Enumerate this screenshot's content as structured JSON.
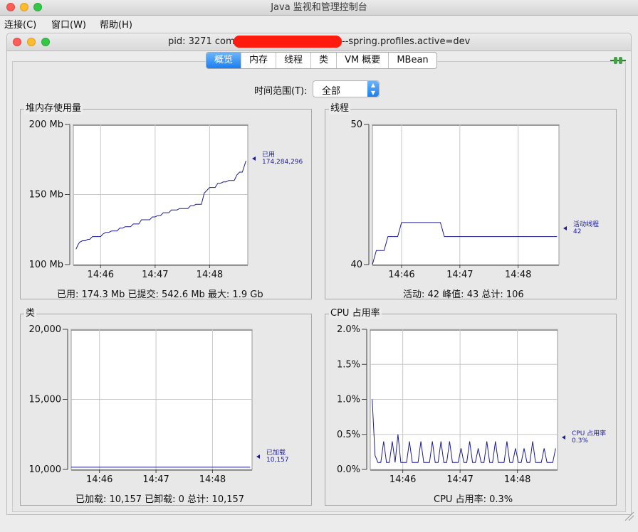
{
  "window": {
    "title": "Java 监视和管理控制台"
  },
  "menu": {
    "items": [
      "连接(C)",
      "窗口(W)",
      "帮助(H)"
    ]
  },
  "inner_window": {
    "title_prefix": "pid: 3271 com",
    "title_suffix": "--spring.profiles.active=dev"
  },
  "tabs": [
    {
      "label": "概览",
      "active": true
    },
    {
      "label": "内存",
      "active": false
    },
    {
      "label": "线程",
      "active": false
    },
    {
      "label": "类",
      "active": false
    },
    {
      "label": "VM 概要",
      "active": false
    },
    {
      "label": "MBean",
      "active": false
    }
  ],
  "time_range": {
    "label": "时间范围(T):",
    "value": "全部"
  },
  "colors": {
    "accent": "#1a7ff0",
    "series": "#1c1c94",
    "redaction": "#ff1c0e"
  },
  "icons": [
    "plug-connected-icon"
  ],
  "panels": {
    "heap": {
      "title": "堆内存使用量",
      "summary": "已用: 174.3 Mb    已提交: 542.6 Mb    最大: 1.9 Gb",
      "legend_name": "已用",
      "legend_value": "174,284,296"
    },
    "threads": {
      "title": "线程",
      "summary": "活动: 42    峰值: 43    总计: 106",
      "legend_name": "活动线程",
      "legend_value": "42"
    },
    "classes": {
      "title": "类",
      "summary": "已加载: 10,157    已卸载: 0    总计: 10,157",
      "legend_name": "已加载",
      "legend_value": "10,157"
    },
    "cpu": {
      "title": "CPU 占用率",
      "summary": "CPU 占用率: 0.3%",
      "legend_name": "CPU 占用率",
      "legend_value": "0.3%"
    }
  },
  "chart_data": [
    {
      "id": "heap",
      "type": "line",
      "series": [
        {
          "name": "已用",
          "x": [
            "14:45:33",
            "14:45:35",
            "14:45:37",
            "14:45:40",
            "14:45:43",
            "14:45:46",
            "14:45:48",
            "14:45:51",
            "14:45:54",
            "14:45:57",
            "14:46:00",
            "14:46:03",
            "14:46:06",
            "14:46:09",
            "14:46:12",
            "14:46:15",
            "14:46:18",
            "14:46:21",
            "14:46:24",
            "14:46:27",
            "14:46:30",
            "14:46:33",
            "14:46:36",
            "14:46:39",
            "14:46:42",
            "14:46:45",
            "14:46:48",
            "14:46:51",
            "14:46:54",
            "14:46:57",
            "14:47:00",
            "14:47:03",
            "14:47:06",
            "14:47:09",
            "14:47:12",
            "14:47:15",
            "14:47:18",
            "14:47:21",
            "14:47:24",
            "14:47:27",
            "14:47:30",
            "14:47:33",
            "14:47:36",
            "14:47:39",
            "14:47:42",
            "14:47:45",
            "14:47:48",
            "14:47:51",
            "14:47:54",
            "14:47:57",
            "14:48:00",
            "14:48:03",
            "14:48:06",
            "14:48:09",
            "14:48:12",
            "14:48:15",
            "14:48:18",
            "14:48:21",
            "14:48:24",
            "14:48:27",
            "14:48:30",
            "14:48:33",
            "14:48:36",
            "14:48:38",
            "14:48:40"
          ],
          "values": [
            111,
            114,
            116,
            117,
            117,
            118,
            118,
            120,
            120,
            120,
            120,
            122,
            123,
            123,
            124,
            124,
            124,
            126,
            126,
            127,
            127,
            127,
            129,
            129,
            129,
            132,
            132,
            132,
            132,
            134,
            134,
            135,
            135,
            137,
            137,
            137,
            139,
            139,
            139,
            140,
            140,
            140,
            140,
            142,
            142,
            143,
            143,
            143,
            151,
            153,
            155,
            155,
            155,
            158,
            158,
            159,
            159,
            160,
            160,
            160,
            164,
            166,
            166,
            170,
            174
          ]
        }
      ],
      "ylim": [
        100,
        200
      ],
      "yticks": [
        "100 Mb",
        "150 Mb",
        "200 Mb"
      ],
      "xticks": [
        "14:46",
        "14:47",
        "14:48"
      ]
    },
    {
      "id": "threads",
      "type": "line",
      "series": [
        {
          "name": "活动线程",
          "x": [
            "14:45:30",
            "14:45:34",
            "14:45:38",
            "14:45:42",
            "14:45:46",
            "14:45:50",
            "14:45:56",
            "14:46:00",
            "14:46:04",
            "14:46:10",
            "14:46:20",
            "14:46:30",
            "14:46:40",
            "14:46:44",
            "14:46:46",
            "14:47:00",
            "14:47:20",
            "14:47:40",
            "14:48:00",
            "14:48:20",
            "14:48:40"
          ],
          "values": [
            40,
            41,
            41,
            41,
            42,
            42,
            42,
            43,
            43,
            43,
            43,
            43,
            43,
            42,
            42,
            42,
            42,
            42,
            42,
            42,
            42
          ]
        }
      ],
      "ylim": [
        40,
        50
      ],
      "yticks": [
        "40",
        "50"
      ],
      "xticks": [
        "14:46",
        "14:47",
        "14:48"
      ]
    },
    {
      "id": "classes",
      "type": "line",
      "series": [
        {
          "name": "已加载",
          "x": [
            "14:45:30",
            "14:46:00",
            "14:46:30",
            "14:47:00",
            "14:47:30",
            "14:48:00",
            "14:48:30",
            "14:48:40"
          ],
          "values": [
            10157,
            10157,
            10157,
            10157,
            10157,
            10157,
            10157,
            10157
          ]
        }
      ],
      "ylim": [
        10000,
        20000
      ],
      "yticks": [
        "10,000",
        "15,000",
        "20,000"
      ],
      "xticks": [
        "14:46",
        "14:47",
        "14:48"
      ]
    },
    {
      "id": "cpu",
      "type": "line",
      "series": [
        {
          "name": "CPU 占用率",
          "x": [
            "14:45:28",
            "14:45:31",
            "14:45:34",
            "14:45:37",
            "14:45:40",
            "14:45:43",
            "14:45:46",
            "14:45:49",
            "14:45:52",
            "14:45:55",
            "14:45:58",
            "14:46:01",
            "14:46:04",
            "14:46:07",
            "14:46:10",
            "14:46:13",
            "14:46:16",
            "14:46:19",
            "14:46:22",
            "14:46:25",
            "14:46:28",
            "14:46:31",
            "14:46:34",
            "14:46:37",
            "14:46:40",
            "14:46:43",
            "14:46:46",
            "14:46:49",
            "14:46:52",
            "14:46:55",
            "14:46:58",
            "14:47:01",
            "14:47:04",
            "14:47:07",
            "14:47:10",
            "14:47:13",
            "14:47:16",
            "14:47:19",
            "14:47:22",
            "14:47:25",
            "14:47:28",
            "14:47:31",
            "14:47:34",
            "14:47:37",
            "14:47:40",
            "14:47:43",
            "14:47:46",
            "14:47:49",
            "14:47:52",
            "14:47:55",
            "14:47:58",
            "14:48:01",
            "14:48:04",
            "14:48:07",
            "14:48:10",
            "14:48:13",
            "14:48:16",
            "14:48:19",
            "14:48:22",
            "14:48:25",
            "14:48:28",
            "14:48:31",
            "14:48:34",
            "14:48:37",
            "14:48:40"
          ],
          "values": [
            1.0,
            0.2,
            0.1,
            0.1,
            0.4,
            0.1,
            0.1,
            0.4,
            0.1,
            0.5,
            0.1,
            0.1,
            0.1,
            0.4,
            0.1,
            0.1,
            0.1,
            0.4,
            0.1,
            0.1,
            0.1,
            0.4,
            0.1,
            0.1,
            0.4,
            0.1,
            0.1,
            0.4,
            0.1,
            0.1,
            0.1,
            0.3,
            0.1,
            0.1,
            0.4,
            0.1,
            0.1,
            0.3,
            0.1,
            0.1,
            0.4,
            0.1,
            0.1,
            0.4,
            0.1,
            0.1,
            0.1,
            0.4,
            0.1,
            0.1,
            0.3,
            0.1,
            0.1,
            0.3,
            0.1,
            0.1,
            0.4,
            0.1,
            0.1,
            0.1,
            0.3,
            0.1,
            0.1,
            0.1,
            0.3
          ]
        }
      ],
      "ylim": [
        0,
        2
      ],
      "yticks": [
        "0.0%",
        "0.5%",
        "1.0%",
        "1.5%",
        "2.0%"
      ],
      "xticks": [
        "14:46",
        "14:47",
        "14:48"
      ]
    }
  ]
}
